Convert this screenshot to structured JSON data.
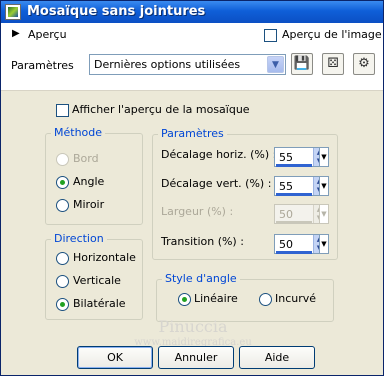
{
  "window": {
    "title": "Mosaïque sans jointures"
  },
  "top": {
    "preview_toggle": "Aperçu",
    "image_preview_label": "Aperçu de l'image",
    "params_label": "Paramètres",
    "preset_value": "Dernières options utilisées"
  },
  "main": {
    "show_preview_label": "Afficher l'aperçu de la mosaïque",
    "method": {
      "title": "Méthode",
      "options": [
        {
          "label": "Bord",
          "selected": false,
          "disabled": true
        },
        {
          "label": "Angle",
          "selected": true,
          "disabled": false
        },
        {
          "label": "Miroir",
          "selected": false,
          "disabled": false
        }
      ]
    },
    "direction": {
      "title": "Direction",
      "options": [
        {
          "label": "Horizontale",
          "selected": false
        },
        {
          "label": "Verticale",
          "selected": false
        },
        {
          "label": "Bilatérale",
          "selected": true
        }
      ]
    },
    "params": {
      "title": "Paramètres",
      "fields": [
        {
          "label": "Décalage horiz. (%) :",
          "value": "55",
          "disabled": false
        },
        {
          "label": "Décalage vert. (%) :",
          "value": "55",
          "disabled": false
        },
        {
          "label": "Largeur (%) :",
          "value": "50",
          "disabled": true
        },
        {
          "label": "Transition (%) :",
          "value": "50",
          "disabled": false
        }
      ]
    },
    "angle_style": {
      "title": "Style d'angle",
      "options": [
        {
          "label": "Linéaire",
          "selected": true
        },
        {
          "label": "Incurvé",
          "selected": false
        }
      ]
    }
  },
  "watermark": {
    "name": "Pinuccia",
    "url": "www.maidiregrafica.eu"
  },
  "footer": {
    "ok": "OK",
    "cancel": "Annuler",
    "help": "Aide"
  }
}
